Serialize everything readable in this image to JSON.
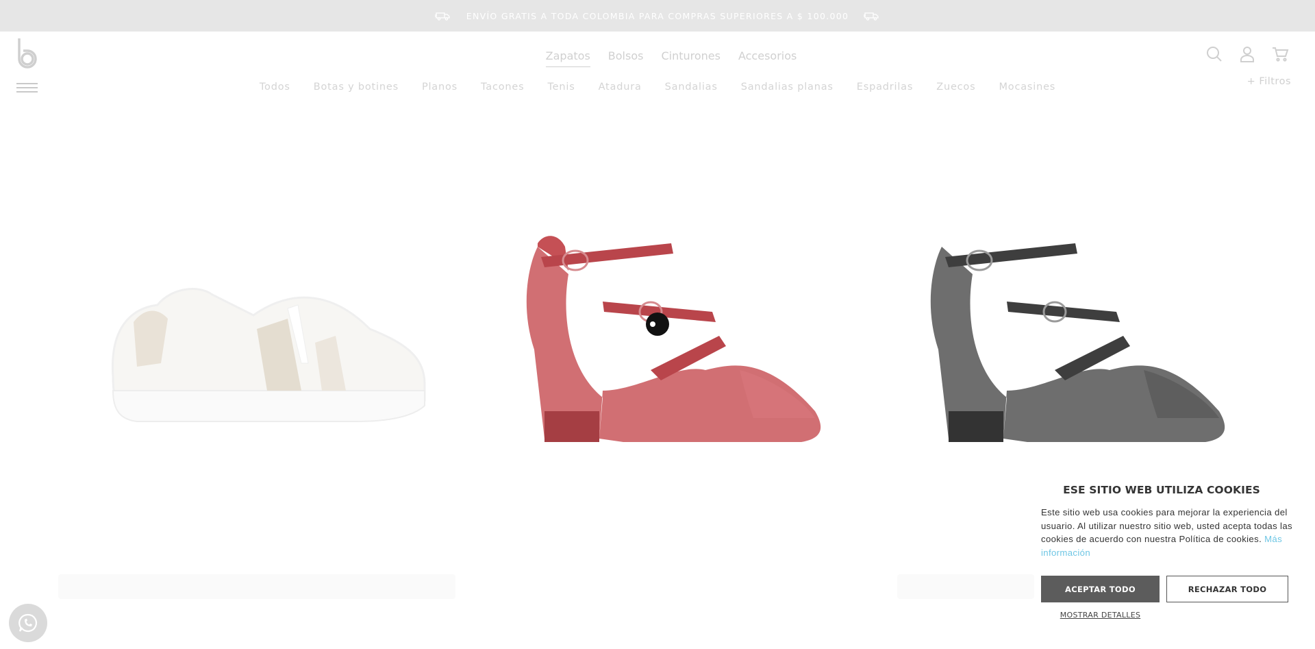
{
  "promo": {
    "text": "ENVÍO GRATIS A TODA COLOMBIA PARA COMPRAS SUPERIORES A $ 100.000",
    "icon_left": "delivery-truck-icon",
    "icon_right": "delivery-truck-icon"
  },
  "header": {
    "logo": "b",
    "main_nav": [
      "Zapatos",
      "Bolsos",
      "Cinturones",
      "Accesorios"
    ],
    "main_nav_active": "Zapatos",
    "sub_nav": [
      "Todos",
      "Botas y botines",
      "Planos",
      "Tacones",
      "Tenis",
      "Atadura",
      "Sandalias",
      "Sandalias planas",
      "Espadrilas",
      "Zuecos",
      "Mocasines"
    ],
    "filters_label": "+ Filtros",
    "icons": [
      "search-icon",
      "user-icon",
      "cart-icon"
    ]
  },
  "products": [
    {
      "name": "white-sneaker",
      "color": "#f2f0ec"
    },
    {
      "name": "red-croc-mary-jane",
      "color": "#b5474c"
    },
    {
      "name": "black-croc-mary-jane",
      "color": "#3a3a3a"
    }
  ],
  "cookie": {
    "title": "ESE SITIO WEB UTILIZA COOKIES",
    "body": "Este sitio web usa cookies para mejorar la experiencia del usuario. Al utilizar nuestro sitio web, usted acepta todas las cookies de acuerdo con nuestra Política de cookies.",
    "more_link": "Más información",
    "accept": "ACEPTAR TODO",
    "reject": "RECHAZAR TODO",
    "details": "MOSTRAR DETALLES"
  },
  "whatsapp_icon": "whatsapp-icon"
}
